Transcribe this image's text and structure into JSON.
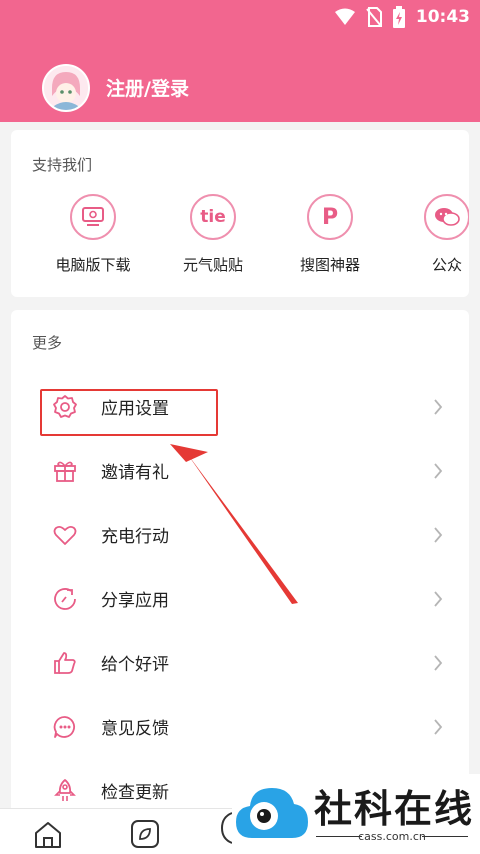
{
  "status_bar": {
    "time": "10:43",
    "icons": [
      "wifi-icon",
      "no-sim-icon",
      "battery-charging-icon"
    ]
  },
  "header": {
    "login_label": "注册/登录",
    "bg_color": "#f2668f"
  },
  "support": {
    "title": "支持我们",
    "items": [
      {
        "label": "电脑版下载",
        "icon": "computer-icon"
      },
      {
        "label": "元气贴贴",
        "icon": "tie-icon",
        "icon_text": "tie"
      },
      {
        "label": "搜图神器",
        "icon": "p-icon",
        "icon_text": "P"
      },
      {
        "label": "公众",
        "icon": "wechat-icon"
      }
    ]
  },
  "more": {
    "title": "更多",
    "items": [
      {
        "label": "应用设置",
        "icon": "gear-icon"
      },
      {
        "label": "邀请有礼",
        "icon": "gift-icon"
      },
      {
        "label": "充电行动",
        "icon": "heart-icon"
      },
      {
        "label": "分享应用",
        "icon": "share-icon"
      },
      {
        "label": "给个好评",
        "icon": "thumbs-up-icon"
      },
      {
        "label": "意见反馈",
        "icon": "chat-icon"
      },
      {
        "label": "检查更新",
        "icon": "rocket-icon"
      }
    ]
  },
  "watermark": {
    "title": "社科在线",
    "subtitle": "cass.com.cn"
  },
  "accent_color": "#ef6a92"
}
